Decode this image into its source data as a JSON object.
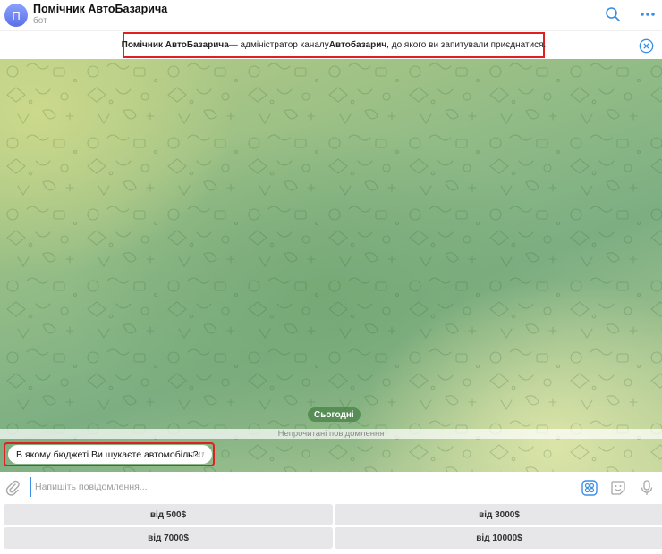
{
  "header": {
    "avatar_letter": "П",
    "title": "Помічник АвтоБазарича",
    "subtitle": "бот",
    "icons": [
      "search-icon",
      "more-icon"
    ]
  },
  "notice": {
    "bot_name": "Помічник АвтоБазарича",
    "text_middle": " — адміністратор каналу ",
    "channel_name": "Автобазарич",
    "text_end": ", до якого ви запитували приєднатися."
  },
  "chat": {
    "date_label": "Сьогодні",
    "unread_label": "Непрочитані повідомлення",
    "message": {
      "text": "В якому бюджеті Ви шукаєте автомобіль?",
      "time": "10:41"
    }
  },
  "composer": {
    "placeholder": "Напишіть повідомлення..."
  },
  "keyboard": {
    "buttons": [
      "від 500$",
      "від 3000$",
      "від 7000$",
      "від 10000$"
    ]
  },
  "colors": {
    "accent": "#3a8ee6",
    "highlight": "#e02020",
    "avatar": "#6c7ff0",
    "date_pill": "#4c8a4c"
  }
}
